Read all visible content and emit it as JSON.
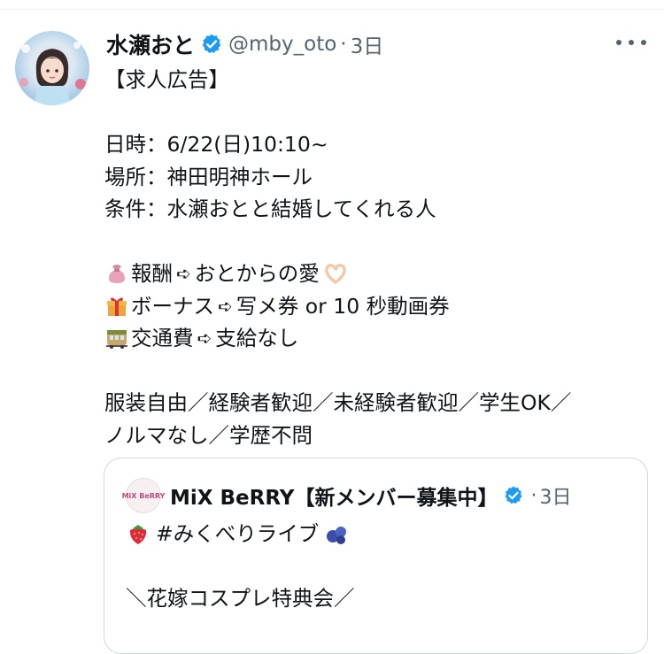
{
  "tweet": {
    "author": {
      "name": "水瀬おと",
      "handle": "@mby_oto",
      "separator": "·",
      "time": "3日"
    },
    "lines": {
      "l0": "【求人広告】",
      "l1": "",
      "l2": "日時：6/22(日)10:10~",
      "l3": "場所：神田明神ホール",
      "l4": "条件：水瀬おとと結婚してくれる人",
      "l5": "",
      "l6a": "報酬",
      "l6b": "おとからの愛",
      "l7a": "ボーナス",
      "l7b": "写メ券 or 10 秒動画券",
      "l8a": "交通費",
      "l8b": "支給なし",
      "l9": "",
      "l10": "服装自由／経験者歓迎／未経験者歓迎／学生OK／",
      "l11": "ノルマなし／学歴不問"
    },
    "arrow_glyph": "➪"
  },
  "quote": {
    "avatar_text": "MiX BeRRY",
    "name": "MiX BeRRY【新メンバー募集中】",
    "separator": "·",
    "time": "3日",
    "line1": "#みくべりライブ",
    "line2": "",
    "line3": "＼花嫁コスプレ特典会／"
  },
  "icons": {
    "verified": "verified-badge-icon",
    "more": "more-options-icon",
    "money_bag": "money-bag-icon",
    "gift": "gift-icon",
    "train": "train-icon",
    "heart_hands": "heart-hands-icon",
    "strawberry": "strawberry-icon",
    "blueberries": "blueberries-icon"
  },
  "colors": {
    "verified_blue": "#1d9bf0",
    "secondary_text": "#536471",
    "border": "#cfd9de"
  }
}
